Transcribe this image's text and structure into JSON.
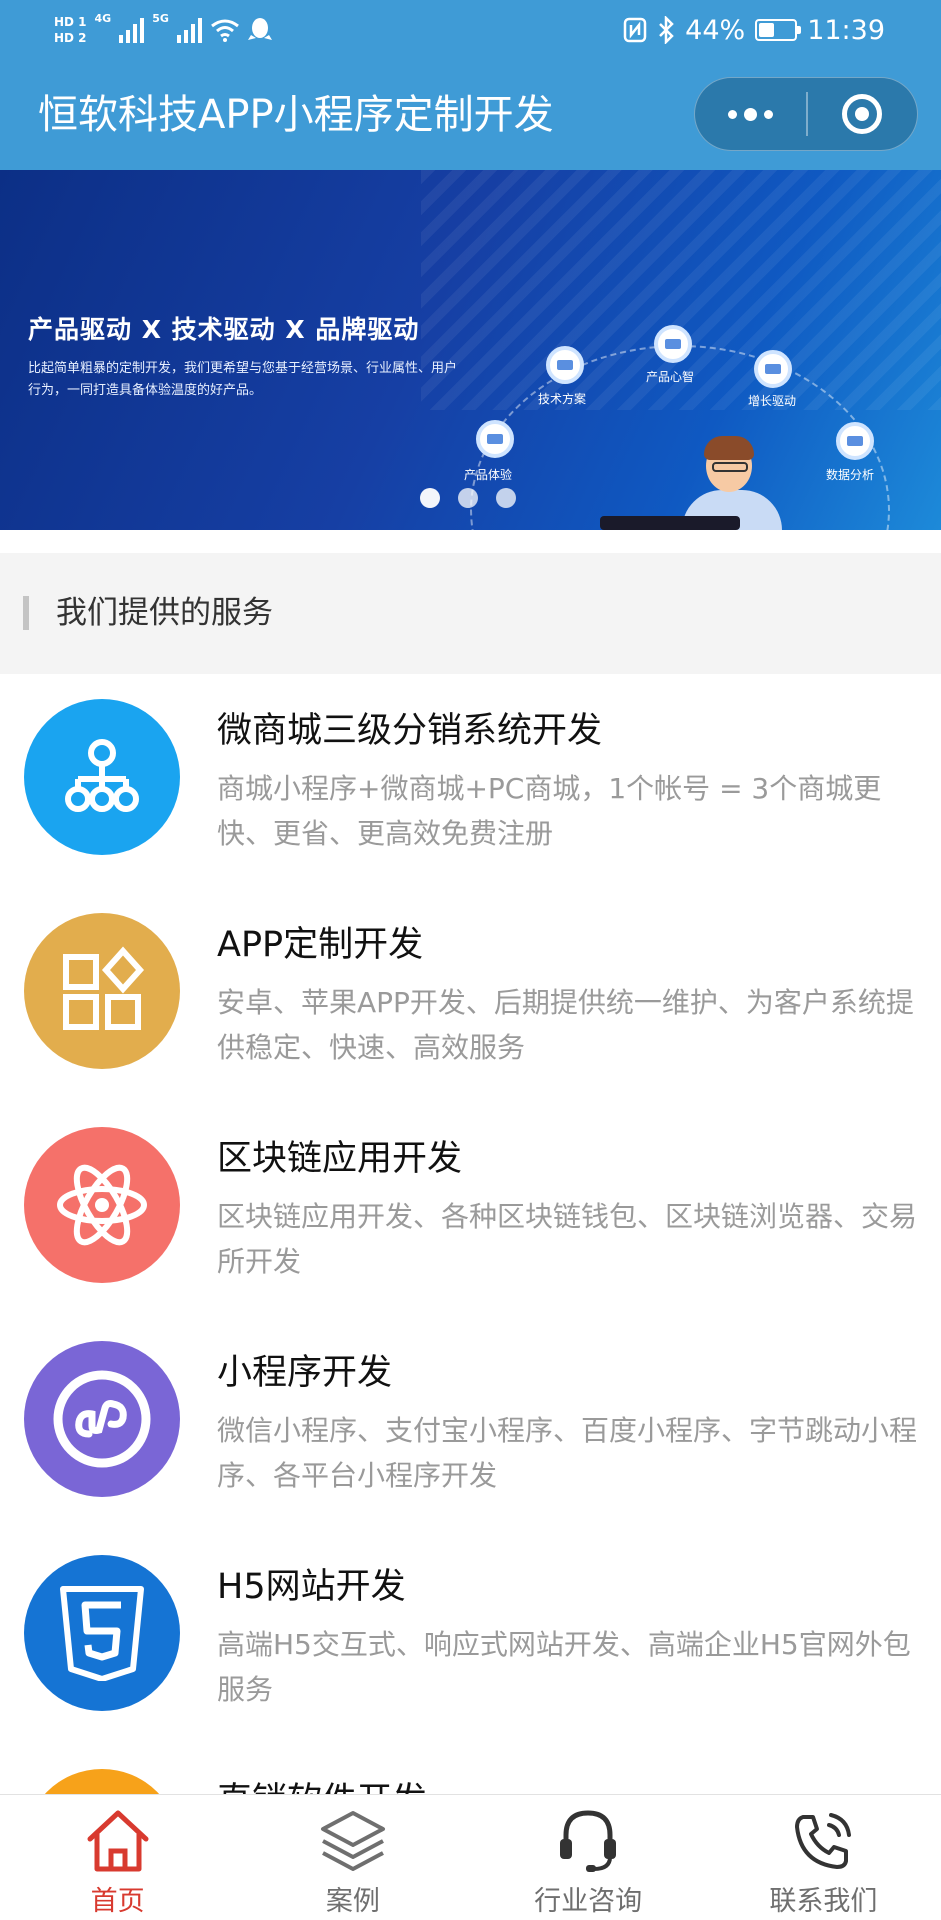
{
  "status_bar": {
    "hd_top": "HD 1",
    "hd_bottom": "HD 2",
    "signal1_label": "4G",
    "signal2_label": "5G",
    "battery": "44%",
    "battery_level": 0.44,
    "time": "11:39",
    "icons": [
      "nfc-icon",
      "bluetooth-icon",
      "wifi-icon",
      "qq-icon"
    ]
  },
  "titlebar": {
    "title": "恒软科技APP小程序定制开发",
    "capsule": {
      "more_icon": "more-dots-icon",
      "close_icon": "target-circle-icon"
    }
  },
  "banner": {
    "headline": "产品驱动 X 技术驱动 X 品牌驱动",
    "subtitle": "比起简单粗暴的定制开发，我们更希望与您基于经营场景、行业属性、用户行为，一同打造具备体验温度的好产品。",
    "nodes": [
      "技术方案",
      "产品心智",
      "增长驱动",
      "产品体验",
      "数据分析"
    ],
    "active_dot": 0,
    "dot_count": 3
  },
  "section": {
    "title": "我们提供的服务"
  },
  "services": [
    {
      "title": "微商城三级分销系统开发",
      "desc": "商城小程序+微商城+PC商城，1个帐号 = 3个商城更快、更省、更高效免费注册",
      "icon": "org-tree-icon",
      "color": "#1aa4f0"
    },
    {
      "title": "APP定制开发",
      "desc": "安卓、苹果APP开发、后期提供统一维护、为客户系统提供稳定、快速、高效服务",
      "icon": "apps-grid-icon",
      "color": "#e2ad4d"
    },
    {
      "title": "区块链应用开发",
      "desc": "区块链应用开发、各种区块链钱包、区块链浏览器、交易所开发",
      "icon": "atom-icon",
      "color": "#f5716a"
    },
    {
      "title": "小程序开发",
      "desc": "微信小程序、支付宝小程序、百度小程序、字节跳动小程序、各平台小程序开发",
      "icon": "miniprogram-icon",
      "color": "#7a66d6"
    },
    {
      "title": "H5网站开发",
      "desc": "高端H5交互式、响应式网站开发、高端企业H5官网外包服务",
      "icon": "html5-icon",
      "color": "#1574d4"
    },
    {
      "title": "直销软件开发",
      "desc": "",
      "icon": "service-icon",
      "color": "#f7a21a"
    }
  ],
  "tabbar": {
    "items": [
      {
        "label": "首页",
        "icon": "home-icon",
        "active": true
      },
      {
        "label": "案例",
        "icon": "layers-icon",
        "active": false
      },
      {
        "label": "行业咨询",
        "icon": "headset-icon",
        "active": false
      },
      {
        "label": "联系我们",
        "icon": "phone-icon",
        "active": false
      }
    ]
  },
  "colors": {
    "header_bg": "#3f9bd6",
    "tab_active": "#d83a2f",
    "tab_inactive": "#6f6f6f",
    "desc_text": "#9a9a9a"
  }
}
